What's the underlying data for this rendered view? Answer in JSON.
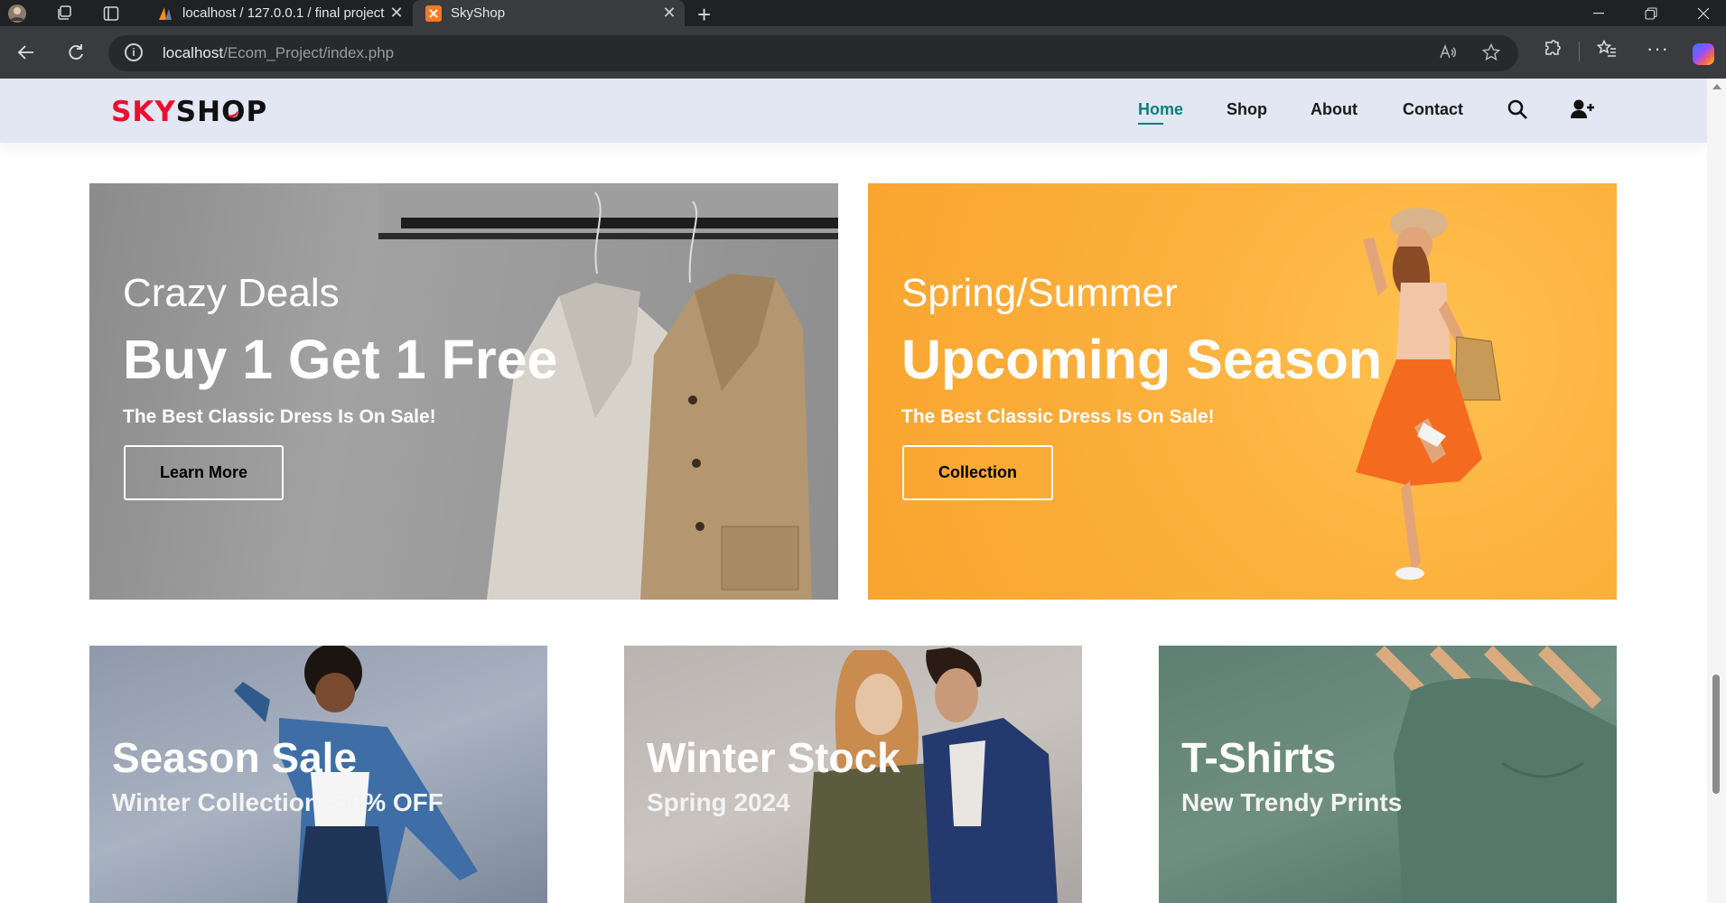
{
  "browser": {
    "tabs": [
      {
        "label": "localhost / 127.0.0.1 / final project",
        "active": false
      },
      {
        "label": "SkyShop",
        "active": true
      }
    ],
    "url_host": "localhost",
    "url_path": "/Ecom_Project/index.php"
  },
  "site": {
    "logo_part1": "SKY",
    "logo_part2": "SH",
    "logo_part3": "O",
    "logo_part4": "P",
    "nav": {
      "home": "Home",
      "shop": "Shop",
      "about": "About",
      "contact": "Contact"
    },
    "accent_color": "#088178"
  },
  "banners": [
    {
      "subtitle": "Crazy Deals",
      "title": "Buy 1 Get 1 Free",
      "text": "The Best Classic Dress Is On Sale!",
      "button": "Learn More"
    },
    {
      "subtitle": "Spring/Summer",
      "title": "Upcoming Season",
      "text": "The Best Classic Dress Is On Sale!",
      "button": "Collection"
    }
  ],
  "small_banners": [
    {
      "title": "Season Sale",
      "subtitle": "Winter Collection -50% OFF"
    },
    {
      "title": "Winter Stock",
      "subtitle": "Spring 2024"
    },
    {
      "title": "T-Shirts",
      "subtitle": "New Trendy Prints"
    }
  ]
}
